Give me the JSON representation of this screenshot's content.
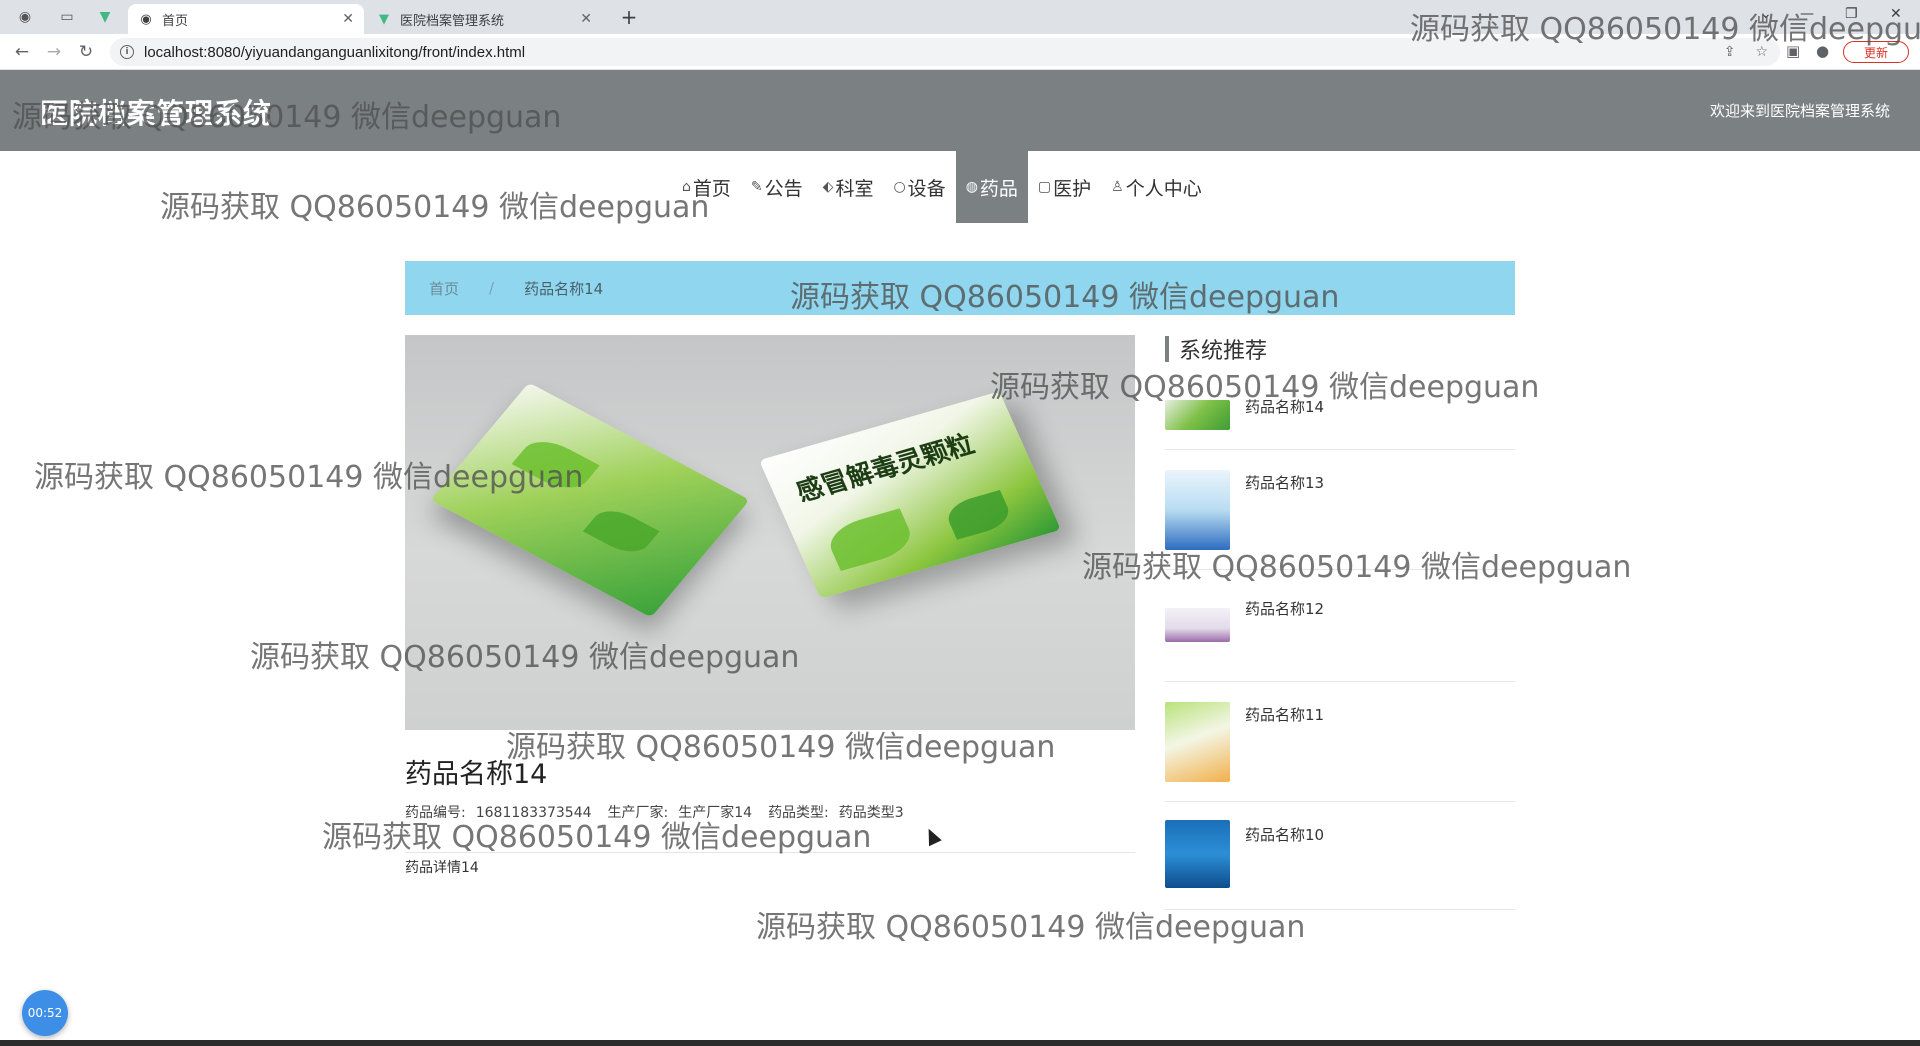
{
  "browser": {
    "tabs": [
      {
        "title": "首页",
        "active": true
      },
      {
        "title": "医院档案管理系统",
        "active": false
      }
    ],
    "url": "localhost:8080/yiyuandanganguanlixitong/front/index.html",
    "update_label": "更新"
  },
  "header": {
    "title": "医院档案管理系统",
    "welcome": "欢迎来到医院档案管理系统"
  },
  "menu": [
    {
      "label": "首页",
      "icon": "home-icon",
      "glyph": "⌂"
    },
    {
      "label": "公告",
      "icon": "palette-icon",
      "glyph": "✎"
    },
    {
      "label": "科室",
      "icon": "tag-icon",
      "glyph": "⬖"
    },
    {
      "label": "设备",
      "icon": "circle-icon",
      "glyph": "○"
    },
    {
      "label": "药品",
      "icon": "globe-icon",
      "glyph": "◍",
      "active": true
    },
    {
      "label": "医护",
      "icon": "clipboard-icon",
      "glyph": "▢"
    },
    {
      "label": "个人中心",
      "icon": "user-icon",
      "glyph": "♙"
    }
  ],
  "breadcrumb": {
    "home": "首页",
    "separator": "/",
    "current": "药品名称14"
  },
  "product": {
    "name": "药品名称14",
    "code_label": "药品编号:",
    "code": "1681183373544",
    "maker_label": "生产厂家:",
    "maker": "生产厂家14",
    "type_label": "药品类型:",
    "type": "药品类型3",
    "detail": "药品详情14",
    "box_text": "感冒解毒灵颗粒"
  },
  "recommend": {
    "title": "系统推荐",
    "items": [
      {
        "name": "药品名称14"
      },
      {
        "name": "药品名称13"
      },
      {
        "name": "药品名称12"
      },
      {
        "name": "药品名称11"
      },
      {
        "name": "药品名称10"
      }
    ]
  },
  "timer": "00:52",
  "watermark": "源码获取 QQ86050149 微信deepguan",
  "colors": {
    "header_bg": "#7b8083",
    "breadcrumb_bg": "#8fd6ee",
    "menu_active_bg": "#7b8083"
  }
}
